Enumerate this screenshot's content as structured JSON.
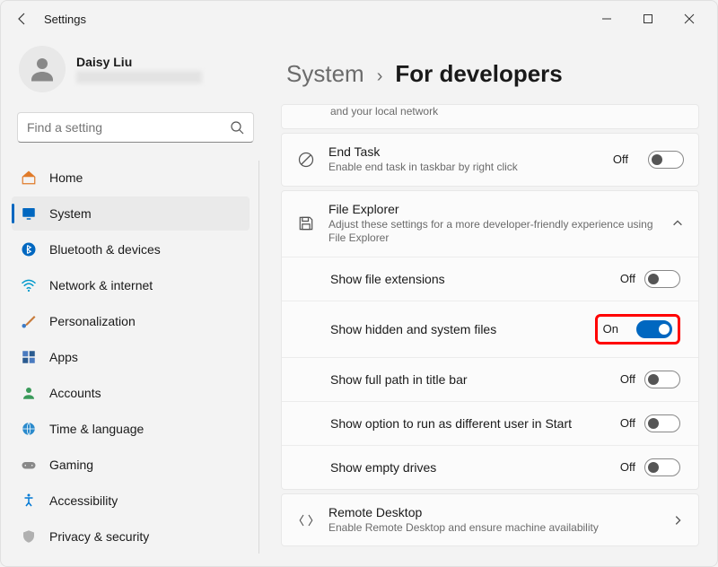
{
  "app_title": "Settings",
  "user": {
    "name": "Daisy Liu"
  },
  "search": {
    "placeholder": "Find a setting"
  },
  "sidebar": {
    "items": [
      {
        "label": "Home",
        "icon": "home"
      },
      {
        "label": "System",
        "icon": "system"
      },
      {
        "label": "Bluetooth & devices",
        "icon": "bluetooth"
      },
      {
        "label": "Network & internet",
        "icon": "wifi"
      },
      {
        "label": "Personalization",
        "icon": "brush"
      },
      {
        "label": "Apps",
        "icon": "apps"
      },
      {
        "label": "Accounts",
        "icon": "person"
      },
      {
        "label": "Time & language",
        "icon": "globe"
      },
      {
        "label": "Gaming",
        "icon": "gamepad"
      },
      {
        "label": "Accessibility",
        "icon": "accessibility"
      },
      {
        "label": "Privacy & security",
        "icon": "shield"
      }
    ],
    "active_index": 1
  },
  "breadcrumb": {
    "parent": "System",
    "current": "For developers"
  },
  "partial_note": "and your local network",
  "settings": {
    "end_task": {
      "title": "End Task",
      "sub": "Enable end task in taskbar by right click",
      "state": "Off",
      "on": false
    },
    "file_explorer": {
      "title": "File Explorer",
      "sub": "Adjust these settings for a more developer-friendly experience using File Explorer",
      "items": [
        {
          "label": "Show file extensions",
          "state": "Off",
          "on": false
        },
        {
          "label": "Show hidden and system files",
          "state": "On",
          "on": true,
          "highlight": true
        },
        {
          "label": "Show full path in title bar",
          "state": "Off",
          "on": false
        },
        {
          "label": "Show option to run as different user in Start",
          "state": "Off",
          "on": false
        },
        {
          "label": "Show empty drives",
          "state": "Off",
          "on": false
        }
      ]
    },
    "remote_desktop": {
      "title": "Remote Desktop",
      "sub": "Enable Remote Desktop and ensure machine availability"
    }
  }
}
